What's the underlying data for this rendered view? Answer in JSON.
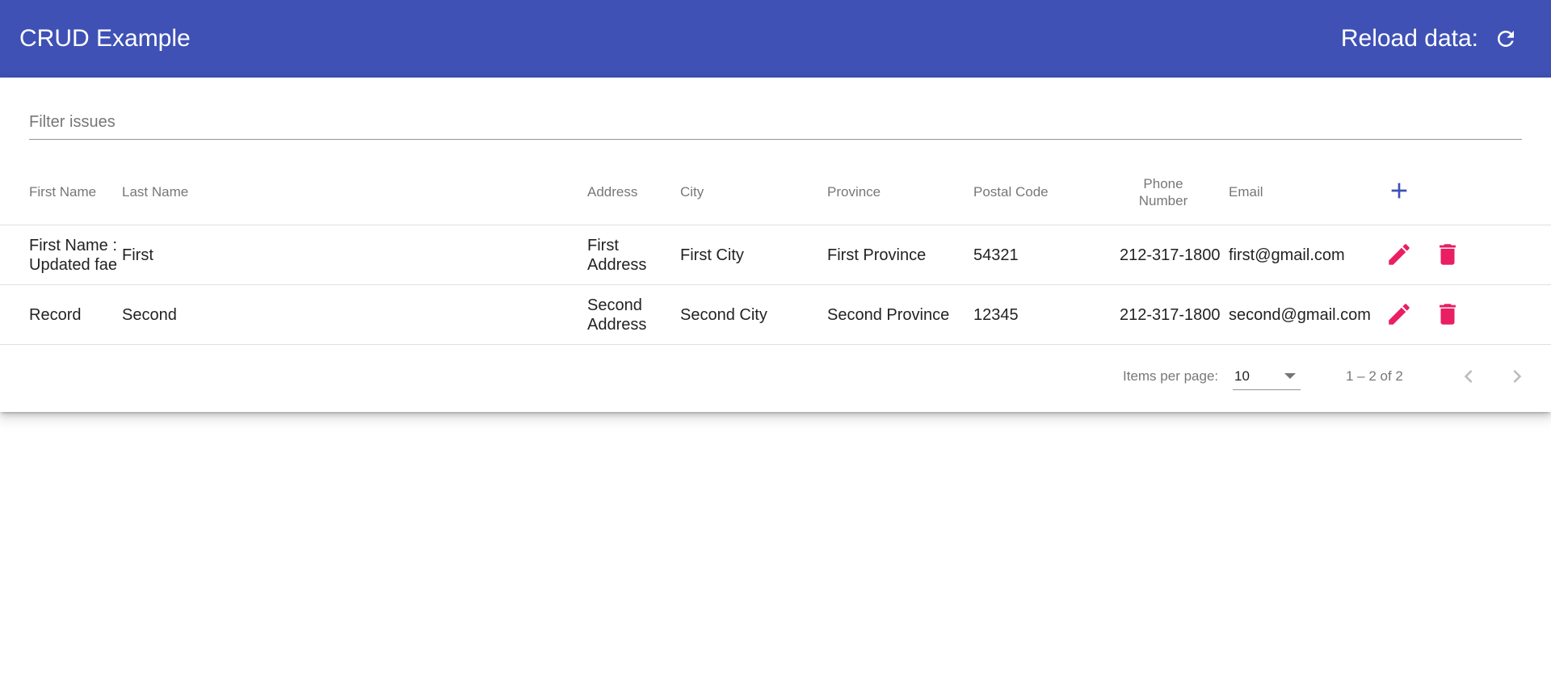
{
  "toolbar": {
    "title": "CRUD Example",
    "reload_label": "Reload data:",
    "bg_color": "#3f51b5",
    "reload_icon": "refresh-icon"
  },
  "filter": {
    "placeholder": "Filter issues",
    "value": ""
  },
  "table": {
    "headers": {
      "first_name": "First Name",
      "last_name": "Last Name",
      "address": "Address",
      "city": "City",
      "province": "Province",
      "postal_code": "Postal Code",
      "phone_line1": "Phone",
      "phone_line2": "Number",
      "email": "Email"
    },
    "add_icon": "add-icon",
    "rows": [
      {
        "first_name": "First Name : Updated fae",
        "last_name": "First",
        "address": "First Address",
        "city": "First City",
        "province": "First Province",
        "postal_code": "54321",
        "phone": "212-317-1800",
        "email": "first@gmail.com"
      },
      {
        "first_name": "Record",
        "last_name": "Second",
        "address": "Second Address",
        "city": "Second City",
        "province": "Second Province",
        "postal_code": "12345",
        "phone": "212-317-1800",
        "email": "second@gmail.com"
      }
    ],
    "edit_icon": "edit-icon",
    "delete_icon": "delete-icon",
    "action_color": "#e91e63",
    "add_color": "#3f51b5"
  },
  "paginator": {
    "items_per_page_label": "Items per page:",
    "page_size": "10",
    "range_label": "1 – 2 of 2",
    "prev_icon": "chevron-left-icon",
    "next_icon": "chevron-right-icon"
  }
}
